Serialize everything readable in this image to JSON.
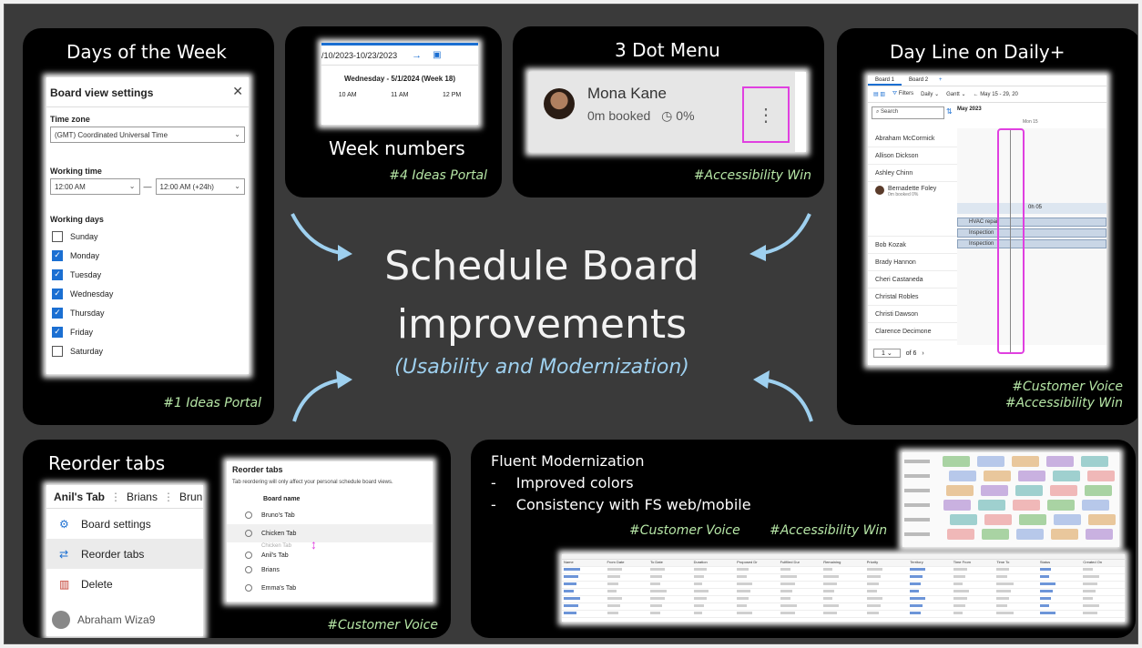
{
  "center": {
    "title_line1": "Schedule Board",
    "title_line2": "improvements",
    "subtitle": "(Usability and Modernization)"
  },
  "panels": {
    "days_of_week": {
      "title": "Days of the Week",
      "tag": "#1 Ideas Portal",
      "dialog": {
        "title": "Board view settings",
        "close_glyph": "✕",
        "time_zone_label": "Time zone",
        "time_zone_value": "(GMT) Coordinated Universal Time",
        "working_time_label": "Working time",
        "start_time": "12:00 AM",
        "dash": "—",
        "end_time": "12:00 AM (+24h)",
        "working_days_label": "Working days",
        "days": [
          {
            "label": "Sunday",
            "checked": false
          },
          {
            "label": "Monday",
            "checked": true
          },
          {
            "label": "Tuesday",
            "checked": true
          },
          {
            "label": "Wednesday",
            "checked": true
          },
          {
            "label": "Thursday",
            "checked": true
          },
          {
            "label": "Friday",
            "checked": true
          },
          {
            "label": "Saturday",
            "checked": false
          }
        ]
      }
    },
    "week_numbers": {
      "caption": "Week numbers",
      "tag": "#4 Ideas Portal",
      "date_range": "/10/2023-10/23/2023",
      "day_header": "Wednesday - 5/1/2024 (Week 18)",
      "times": [
        "10 AM",
        "11 AM",
        "12 PM"
      ]
    },
    "three_dot": {
      "title": "3 Dot Menu",
      "tag": "#Accessibility Win",
      "name": "Mona Kane",
      "booked": "0m booked",
      "percent": "0%",
      "dots_glyph": "⋮"
    },
    "day_line": {
      "title": "Day Line on Daily+",
      "tag1": "#Customer Voice",
      "tag2": "#Accessibility Win",
      "tabs": [
        "Board 1",
        "Board 2",
        "+"
      ],
      "toolbar": [
        "Filters",
        "Daily",
        "Gantt",
        "May 15 - 29, 20"
      ],
      "search_placeholder": "Search",
      "month_label": "May 2023",
      "day_label": "Mon 15",
      "resources": [
        "Abraham McCormick",
        "Allison Dickson",
        "Ashley Chinn",
        "Bernadette Foley",
        "Bob Kozak",
        "Brady Hannon",
        "Cheri Castaneda",
        "Christal Robles",
        "Christi Dawson",
        "Clarence Decimone"
      ],
      "bernadette_sub": "0m booked  0%",
      "bars": [
        "HVAC repair",
        "Inspection",
        "Inspection"
      ],
      "bar_label": "0h 05",
      "pager": "1",
      "pager_of": "of 6"
    },
    "reorder": {
      "title": "Reorder tabs",
      "tag": "#Customer Voice",
      "tabs": [
        "Anil's Tab",
        "Brians",
        "Brun"
      ],
      "menu": [
        {
          "label": "Board settings",
          "icon": "gear-icon"
        },
        {
          "label": "Reorder tabs",
          "icon": "swap-icon"
        },
        {
          "label": "Delete",
          "icon": "trash-icon"
        }
      ],
      "bottom_name": "Abraham Wiza9",
      "dialog_title": "Reorder tabs",
      "dialog_desc": "Tab reordering will only affect your personal schedule board views.",
      "col_header": "Board name",
      "rows": [
        "Bruno's Tab",
        "Chicken Tab",
        "Chicken Tab",
        "Anil's Tab",
        "Brians",
        "Emma's Tab"
      ]
    },
    "fluent": {
      "title": "Fluent Modernization",
      "bullets": [
        "Improved colors",
        "Consistency with FS web/mobile"
      ],
      "bullet_glyph": "-",
      "tag1": "#Customer Voice",
      "tag2": "#Accessibility Win"
    }
  }
}
